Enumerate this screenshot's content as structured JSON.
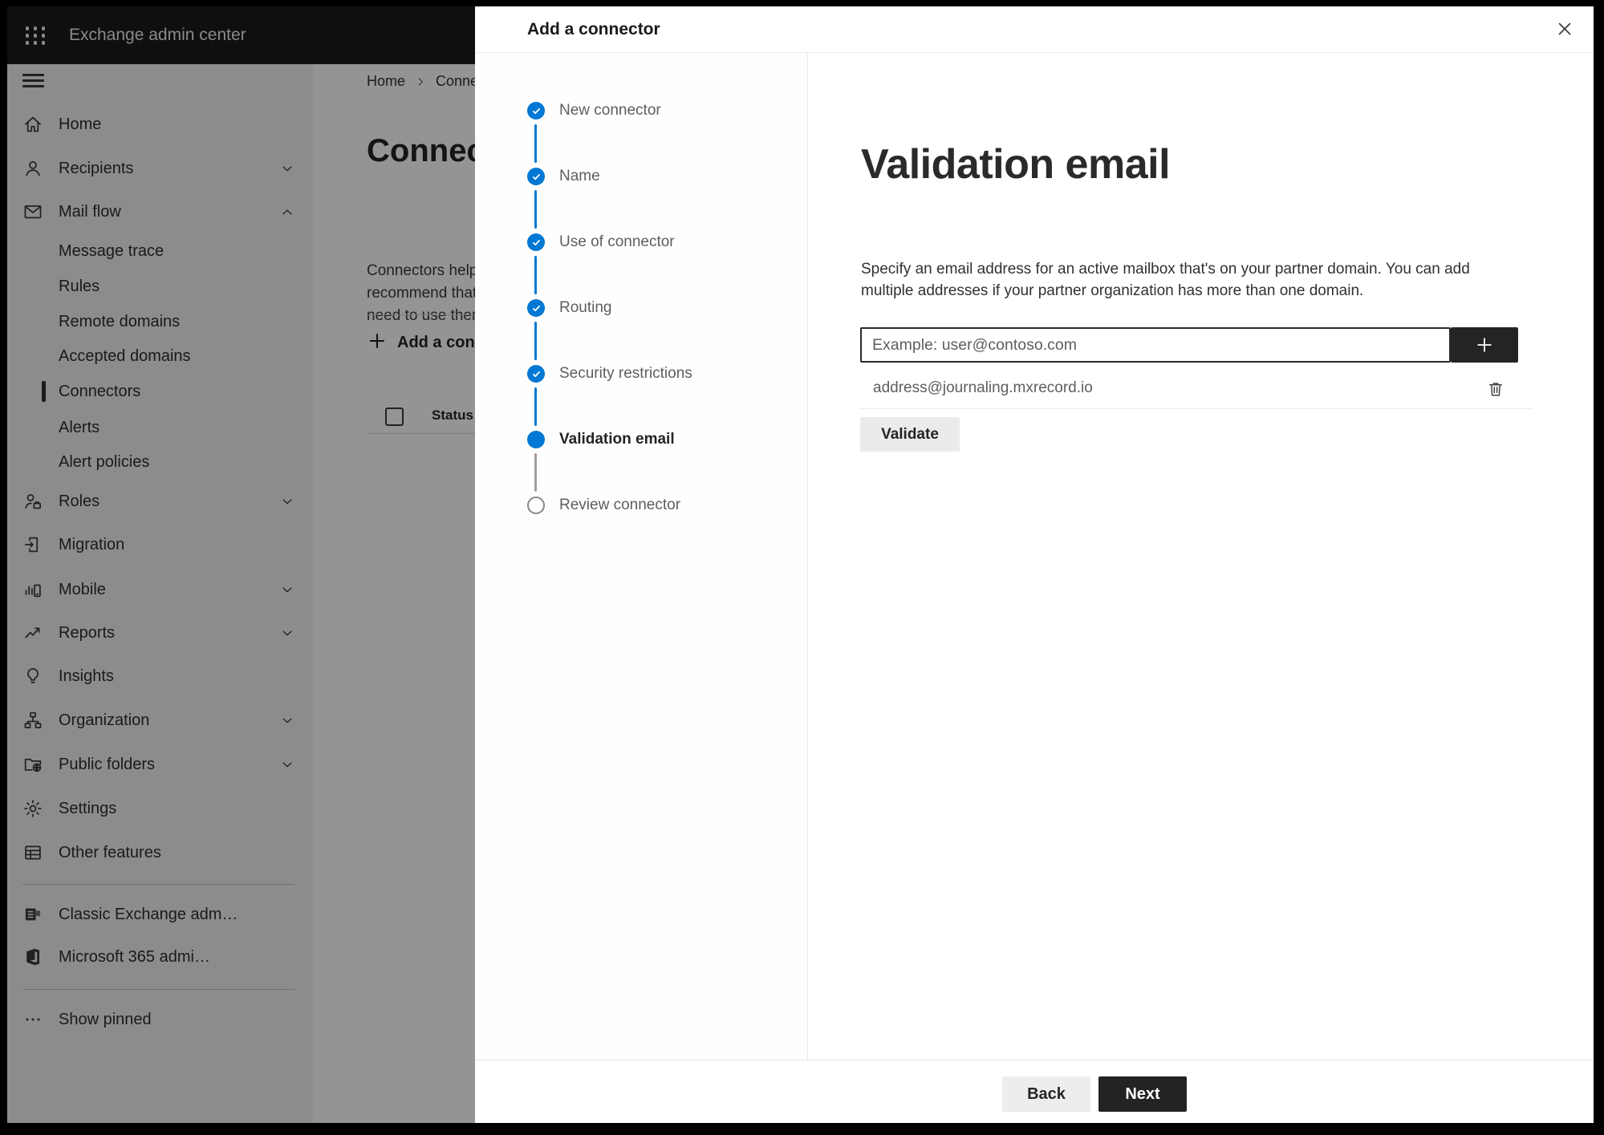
{
  "topbar": {
    "title": "Exchange admin center"
  },
  "sidebar": {
    "items": [
      {
        "label": "Home",
        "icon": "home",
        "type": "top"
      },
      {
        "label": "Recipients",
        "icon": "person",
        "type": "top",
        "chevron": "down"
      },
      {
        "label": "Mail flow",
        "icon": "mail",
        "type": "top",
        "chevron": "up"
      },
      {
        "label": "Message trace",
        "type": "sub"
      },
      {
        "label": "Rules",
        "type": "sub"
      },
      {
        "label": "Remote domains",
        "type": "sub"
      },
      {
        "label": "Accepted domains",
        "type": "sub"
      },
      {
        "label": "Connectors",
        "type": "sub",
        "selected": true
      },
      {
        "label": "Alerts",
        "type": "sub"
      },
      {
        "label": "Alert policies",
        "type": "sub"
      },
      {
        "label": "Roles",
        "icon": "roles",
        "type": "top",
        "chevron": "down"
      },
      {
        "label": "Migration",
        "icon": "migration",
        "type": "top"
      },
      {
        "label": "Mobile",
        "icon": "mobile",
        "type": "top",
        "chevron": "down"
      },
      {
        "label": "Reports",
        "icon": "reports",
        "type": "top",
        "chevron": "down"
      },
      {
        "label": "Insights",
        "icon": "insights",
        "type": "top"
      },
      {
        "label": "Organization",
        "icon": "organization",
        "type": "top",
        "chevron": "down"
      },
      {
        "label": "Public folders",
        "icon": "public-folders",
        "type": "top",
        "chevron": "down"
      },
      {
        "label": "Settings",
        "icon": "settings",
        "type": "top"
      },
      {
        "label": "Other features",
        "icon": "other-features",
        "type": "top"
      },
      {
        "label": "Classic Exchange adm…",
        "icon": "classic-exchange",
        "type": "top"
      },
      {
        "label": "Microsoft 365 admi…",
        "icon": "m365",
        "type": "top"
      },
      {
        "label": "Show pinned",
        "icon": "more",
        "type": "top"
      }
    ]
  },
  "page": {
    "breadcrumb": {
      "home": "Home",
      "current": "Connectors"
    },
    "title": "Connectors",
    "description_lines": [
      "Connectors help",
      "recommend that",
      "need to use them"
    ],
    "add_button": "Add a connector",
    "status_header": "Status"
  },
  "modal": {
    "title": "Add a connector",
    "steps": [
      {
        "label": "New connector",
        "state": "done"
      },
      {
        "label": "Name",
        "state": "done"
      },
      {
        "label": "Use of connector",
        "state": "done"
      },
      {
        "label": "Routing",
        "state": "done"
      },
      {
        "label": "Security restrictions",
        "state": "done"
      },
      {
        "label": "Validation email",
        "state": "current"
      },
      {
        "label": "Review connector",
        "state": "upcoming"
      }
    ],
    "content": {
      "heading": "Validation email",
      "description_line1": "Specify an email address for an active mailbox that's on your partner domain. You can add",
      "description_line2": "multiple addresses if your partner organization has more than one domain.",
      "email_input": {
        "value": "",
        "placeholder": "Example: user@contoso.com"
      },
      "added_addresses": [
        "address@journaling.mxrecord.io"
      ],
      "validate_button": "Validate"
    },
    "footer": {
      "back_button": "Back",
      "next_button": "Next"
    }
  },
  "colors": {
    "accent": "#0078d4",
    "dark_button": "#242323",
    "topbar_bg": "#1b1a19",
    "divider": "#e5e3e1",
    "text": "#323130",
    "secondary_text": "#605e5c"
  }
}
